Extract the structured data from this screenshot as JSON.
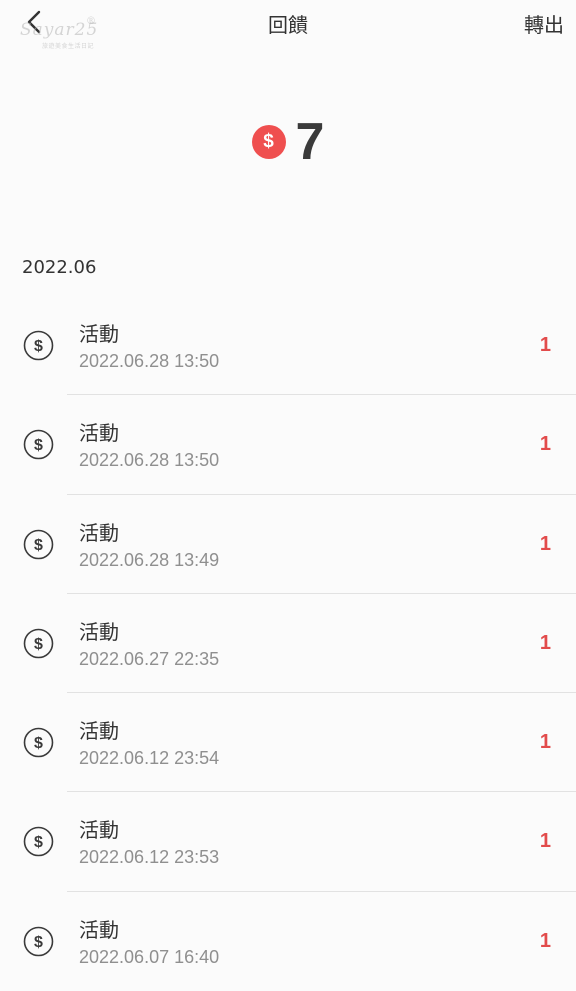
{
  "header": {
    "back_icon": "chevron-left-icon",
    "title": "回饋",
    "action_label": "轉出"
  },
  "watermark": {
    "text": "Sayar25",
    "subtext": "旅遊美食生活日記",
    "mark": "®"
  },
  "balance": {
    "currency_symbol": "$",
    "value": "7",
    "badge_color": "#ef4f4f"
  },
  "month": "2022.06",
  "transactions": [
    {
      "title": "活動",
      "time": "2022.06.28 13:50",
      "amount": "1",
      "icon": "dollar-coin-icon"
    },
    {
      "title": "活動",
      "time": "2022.06.28 13:50",
      "amount": "1",
      "icon": "dollar-coin-icon"
    },
    {
      "title": "活動",
      "time": "2022.06.28 13:49",
      "amount": "1",
      "icon": "dollar-coin-icon"
    },
    {
      "title": "活動",
      "time": "2022.06.27 22:35",
      "amount": "1",
      "icon": "dollar-coin-icon"
    },
    {
      "title": "活動",
      "time": "2022.06.12 23:54",
      "amount": "1",
      "icon": "dollar-coin-icon"
    },
    {
      "title": "活動",
      "time": "2022.06.12 23:53",
      "amount": "1",
      "icon": "dollar-coin-icon"
    },
    {
      "title": "活動",
      "time": "2022.06.07 16:40",
      "amount": "1",
      "icon": "dollar-coin-icon"
    }
  ],
  "colors": {
    "amount": "#e24b4b",
    "background": "#fbfbfb"
  }
}
